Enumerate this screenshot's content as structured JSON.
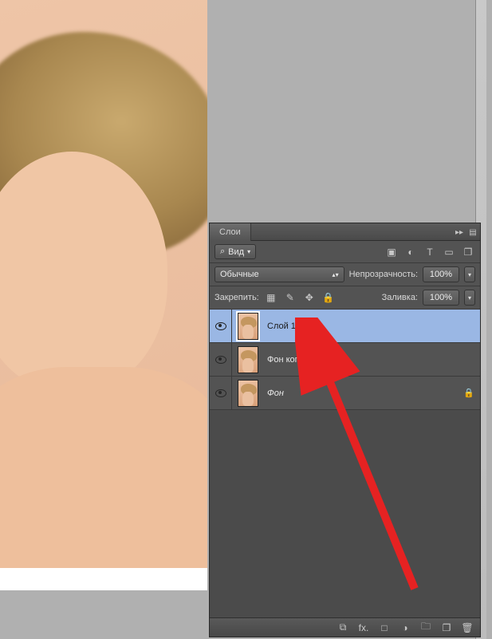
{
  "panel": {
    "tab_title": "Слои",
    "filter_label": "Вид",
    "blend_mode": "Обычные",
    "opacity_label": "Непрозрачность:",
    "opacity_value": "100%",
    "lock_label": "Закрепить:",
    "fill_label": "Заливка:",
    "fill_value": "100%"
  },
  "layers": [
    {
      "name": "Слой 1",
      "visible": true,
      "selected": true,
      "locked": false,
      "italic": false
    },
    {
      "name": "Фон копия",
      "visible": true,
      "selected": false,
      "locked": false,
      "italic": false
    },
    {
      "name": "Фон",
      "visible": true,
      "selected": false,
      "locked": true,
      "italic": true
    }
  ],
  "icons": {
    "search": "⌕",
    "image": "▣",
    "adjust": "◐",
    "type": "T",
    "shape": "▭",
    "smart": "❐",
    "pixels": "▦",
    "brush": "✎",
    "move": "✥",
    "lock": "🔒",
    "link": "⧉",
    "fx": "fx.",
    "mask": "□",
    "circle": "◑",
    "folder": "🗀",
    "new": "❐",
    "trash": "🗑",
    "collapse": "▸▸",
    "menu": "▤"
  }
}
